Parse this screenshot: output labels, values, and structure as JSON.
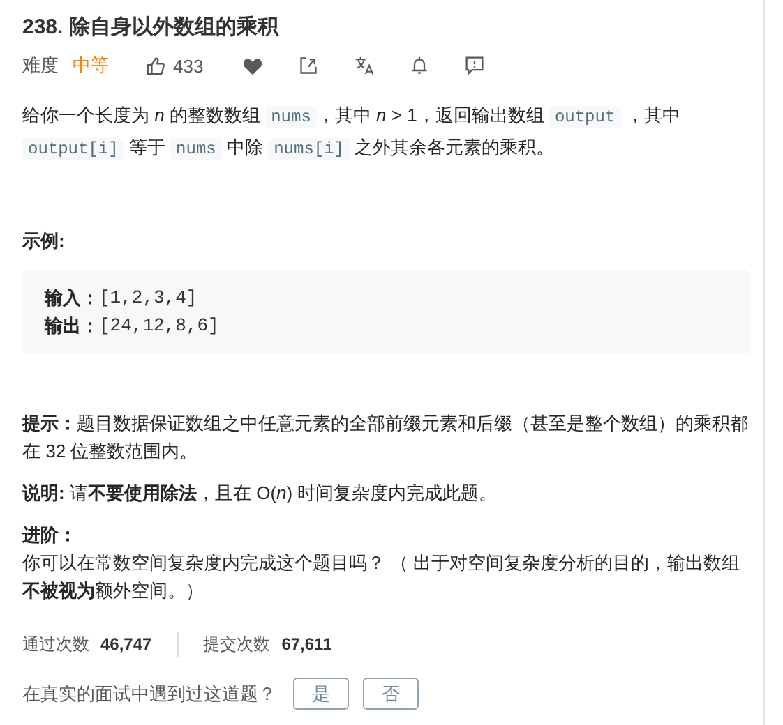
{
  "title": "238. 除自身以外数组的乘积",
  "meta": {
    "difficulty_label": "难度",
    "difficulty": "中等",
    "likes": "433"
  },
  "description": [
    {
      "kind": "text",
      "text": "给你一个长度为 *n* 的整数数组 "
    },
    {
      "kind": "code",
      "text": "nums"
    },
    {
      "kind": "text",
      "text": "，其中 *n* > 1，返回输出数组 "
    },
    {
      "kind": "code",
      "text": "output"
    },
    {
      "kind": "text",
      "text": " ，其中 "
    },
    {
      "kind": "code",
      "text": "output[i]"
    },
    {
      "kind": "text",
      "text": " 等于 "
    },
    {
      "kind": "code",
      "text": "nums"
    },
    {
      "kind": "text",
      "text": " 中除 "
    },
    {
      "kind": "code",
      "text": "nums[i]"
    },
    {
      "kind": "text",
      "text": " 之外其余各元素的乘积。"
    }
  ],
  "example": {
    "heading": "示例:",
    "lines": [
      {
        "label": "输入：",
        "value": "[1,2,3,4]"
      },
      {
        "label": "输出：",
        "value": "[24,12,8,6]"
      }
    ]
  },
  "notes": [
    {
      "kind": "paragraph",
      "text": "**提示：**题目数据保证数组之中任意元素的全部前缀元素和后缀（甚至是整个数组）的乘积都在 32 位整数范围内。"
    },
    {
      "kind": "paragraph",
      "text": "**说明:** 请**不要使用除法**，且在 O(*n*) 时间复杂度内完成此题。"
    },
    {
      "kind": "heading",
      "text": "进阶："
    },
    {
      "kind": "paragraph",
      "text": "你可以在常数空间复杂度内完成这个题目吗？ （ 出于对空间复杂度分析的目的，输出数组**不被视为**额外空间。）"
    }
  ],
  "stats": [
    {
      "label": "通过次数",
      "value": "46,747"
    },
    {
      "label": "提交次数",
      "value": "67,611"
    }
  ],
  "feedback": {
    "question": "在真实的面试中遇到过这道题？",
    "buttons": [
      "是",
      "否"
    ]
  }
}
